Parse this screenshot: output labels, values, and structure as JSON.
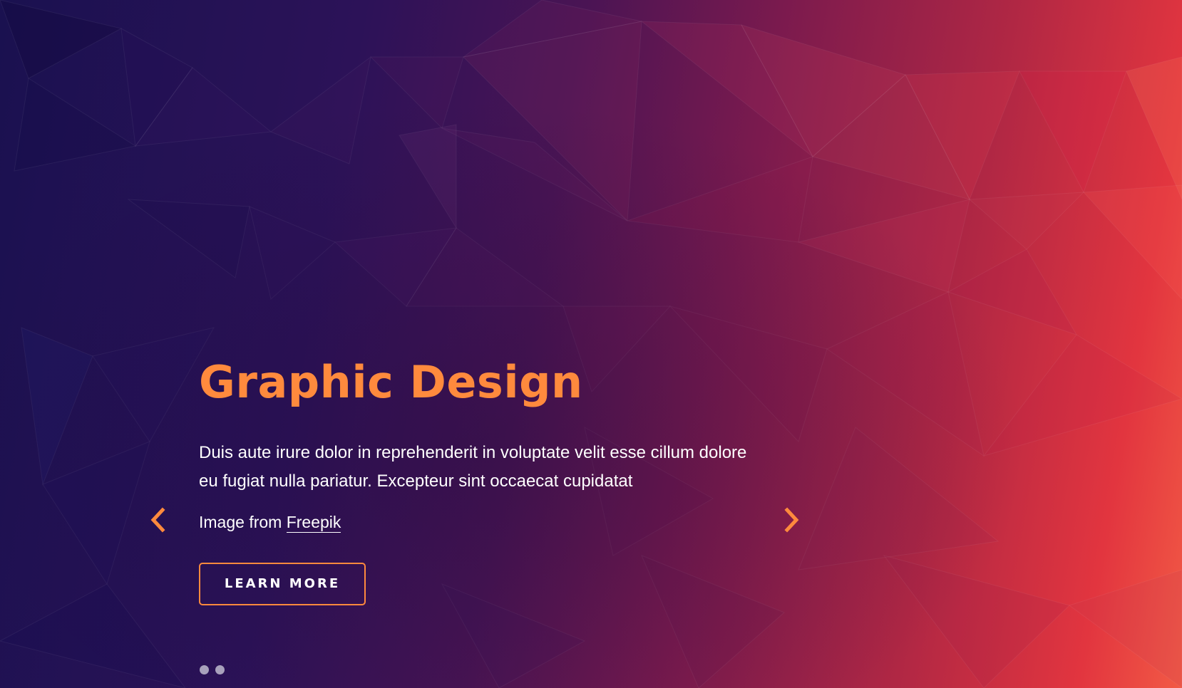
{
  "slide": {
    "title": "Graphic Design",
    "description": "Duis aute irure dolor in reprehenderit in voluptate velit esse cillum dolore eu fugiat nulla pariatur. Excepteur sint occaecat cupidatat",
    "credit_prefix": "Image from ",
    "credit_link": "Freepik",
    "cta_label": "LEARN MORE"
  },
  "controls": {
    "prev_icon": "chevron-left-icon",
    "next_icon": "chevron-right-icon",
    "dots_count": 2
  },
  "colors": {
    "accent": "#ff8a3d",
    "text": "#ffffff",
    "dot": "#a8a1bc",
    "bg_left": "#1a1150",
    "bg_right": "#e2353f"
  }
}
